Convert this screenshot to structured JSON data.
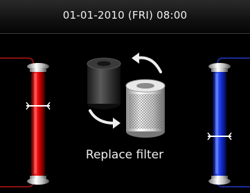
{
  "status_bar": {
    "datetime": "01-01-2010 (FRI) 08:00"
  },
  "main": {
    "message": "Replace filter",
    "icons": [
      "old-filter-icon",
      "new-filter-icon",
      "replace-arrows-icon"
    ]
  },
  "gauges": {
    "left": {
      "color": "#e01010",
      "bracket_color": "#8a1010"
    },
    "right": {
      "color": "#1a35e8",
      "bracket_color": "#1a2c9a"
    }
  }
}
